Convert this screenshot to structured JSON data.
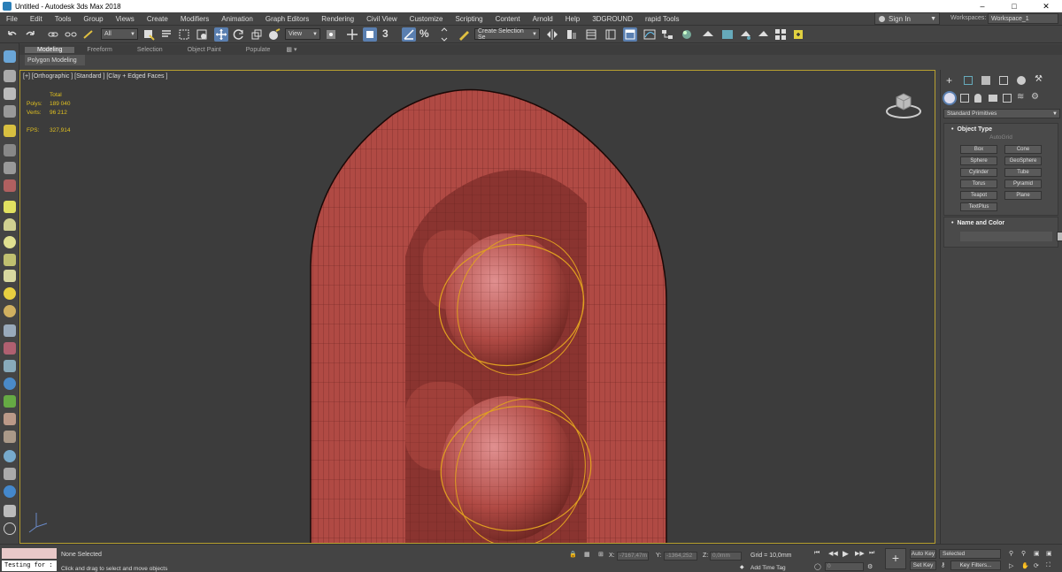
{
  "window": {
    "title": "Untitled - Autodesk 3ds Max 2018",
    "app_icon": "3dsmax-icon",
    "controls": [
      "minimize-icon",
      "maximize-icon",
      "close-icon"
    ]
  },
  "menu": [
    "File",
    "Edit",
    "Tools",
    "Group",
    "Views",
    "Create",
    "Modifiers",
    "Animation",
    "Graph Editors",
    "Rendering",
    "Civil View",
    "Customize",
    "Scripting",
    "Content",
    "Arnold",
    "Help",
    "3DGROUND",
    "rapid Tools"
  ],
  "account": {
    "sign_in": "Sign In",
    "workspaces_label": "Workspaces:",
    "workspace": "Workspace_1"
  },
  "toolbar": {
    "selection_filter": "All",
    "reference_coord": "View",
    "named_selection": "Create Selection Se",
    "snap_label": "3",
    "angle_snap_label": "%"
  },
  "ribbon": {
    "tabs": [
      "Modeling",
      "Freeform",
      "Selection",
      "Object Paint",
      "Populate"
    ],
    "active_tab": "Modeling",
    "sub_label": "Polygon Modeling"
  },
  "viewport": {
    "label": "[+] [Orthographic ] [Standard ] [Clay + Edged Faces ]",
    "stats": {
      "header": "Total",
      "polys_label": "Polys:",
      "polys": "189 040",
      "verts_label": "Verts:",
      "verts": "96 212",
      "fps_label": "FPS:",
      "fps": "327,914"
    },
    "model_color": "#c0504a",
    "selection_color": "#e0a020"
  },
  "command_panel": {
    "category": "Standard Primitives",
    "object_type_title": "Object Type",
    "autogrid": "AutoGrid",
    "primitives": [
      "Box",
      "Cone",
      "Sphere",
      "GeoSphere",
      "Cylinder",
      "Tube",
      "Torus",
      "Pyramid",
      "Teapot",
      "Plane",
      "TextPlus"
    ],
    "name_color_title": "Name and Color"
  },
  "status": {
    "maxscript_line": "Testing for :",
    "selection": "None Selected",
    "prompt": "Click and drag to select and move objects",
    "x_label": "X:",
    "x_value": "-7167,47m",
    "y_label": "Y:",
    "y_value": "-1364,252",
    "z_label": "Z:",
    "z_value": "0,0mm",
    "grid": "Grid = 10,0mm",
    "add_time_tag": "Add Time Tag",
    "frame": "0",
    "auto_key": "Auto Key",
    "set_key": "Set Key",
    "key_mode": "Selected",
    "key_filters": "Key Filters..."
  }
}
